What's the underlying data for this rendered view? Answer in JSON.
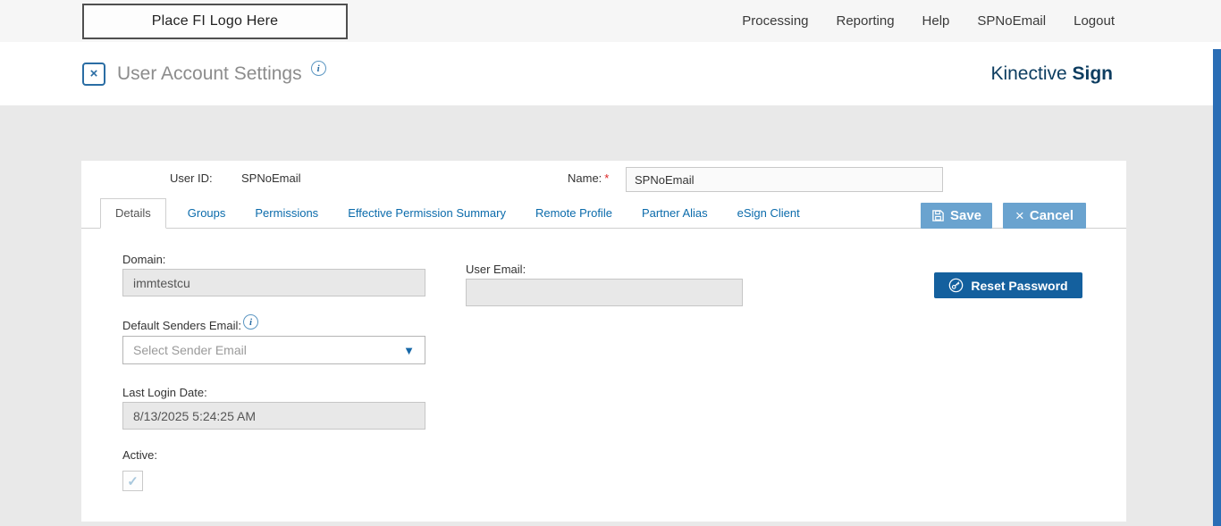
{
  "topbar": {
    "logo_placeholder": "Place FI Logo Here",
    "nav": [
      {
        "label": "Processing"
      },
      {
        "label": "Reporting"
      },
      {
        "label": "Help"
      },
      {
        "label": "SPNoEmail"
      },
      {
        "label": "Logout"
      }
    ]
  },
  "header": {
    "title": "User Account Settings",
    "brand_first": "Kinective ",
    "brand_second": "Sign"
  },
  "icons": {
    "title_glyph": "×",
    "info": "i",
    "cancel": "×",
    "dropdown_arrow": "▼",
    "check": "✓"
  },
  "card": {
    "user_id_label": "User ID:",
    "user_id_value": "SPNoEmail",
    "name_label": "Name:",
    "name_required": "*",
    "name_value": "SPNoEmail",
    "tabs": [
      {
        "label": "Details",
        "active": true
      },
      {
        "label": "Groups",
        "active": false
      },
      {
        "label": "Permissions",
        "active": false
      },
      {
        "label": "Effective Permission Summary",
        "active": false
      },
      {
        "label": "Remote Profile",
        "active": false
      },
      {
        "label": "Partner Alias",
        "active": false
      },
      {
        "label": "eSign Client",
        "active": false
      }
    ],
    "save_label": "Save",
    "cancel_label": "Cancel",
    "form": {
      "domain_label": "Domain:",
      "domain_value": "immtestcu",
      "user_email_label": "User Email:",
      "user_email_value": "",
      "reset_password_label": "Reset Password",
      "default_senders_email_label": "Default Senders Email:",
      "sender_email_placeholder": "Select Sender Email",
      "last_login_label": "Last Login Date:",
      "last_login_value": "8/13/2025 5:24:25 AM",
      "active_label": "Active:",
      "active_checked": true
    }
  },
  "colors": {
    "accent_blue": "#0b6bab",
    "button_blue": "#6aa3cf",
    "dark_blue": "#14609e",
    "brand_navy": "#0d3d60",
    "scrollbar_blue": "#2a6db5"
  }
}
